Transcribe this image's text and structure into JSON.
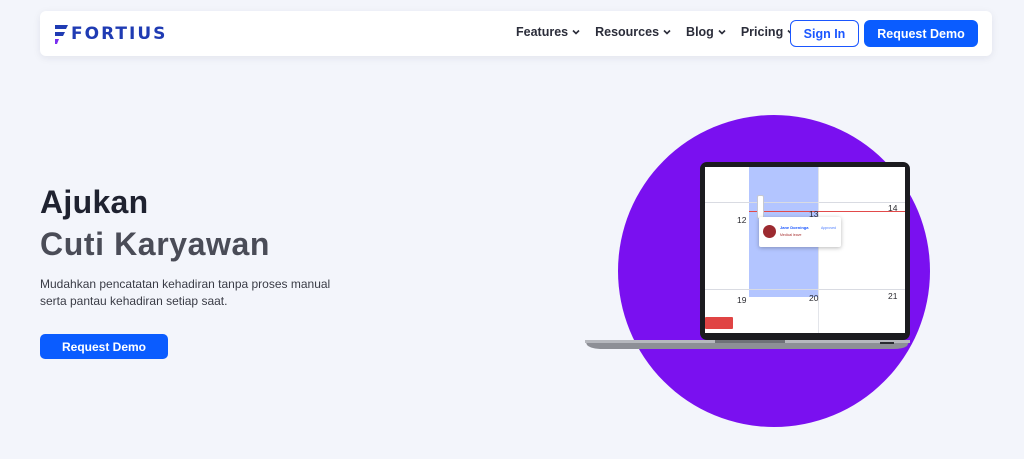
{
  "brand": {
    "name": "FORTIUS",
    "logo_icon": "fortius-logo-icon",
    "color": "#1f3bb3",
    "accent": "#7a2ff0"
  },
  "nav": {
    "items": [
      {
        "label": "Features"
      },
      {
        "label": "Resources"
      },
      {
        "label": "Blog"
      },
      {
        "label": "Pricing"
      }
    ],
    "signin_label": "Sign In",
    "demo_label": "Request Demo"
  },
  "hero": {
    "title_line1": "Ajukan",
    "title_line2": "Cuti Karyawan",
    "description": "Mudahkan pencatatan kehadiran tanpa proses manual serta pantau kehadiran setiap saat.",
    "cta_label": "Request Demo"
  },
  "mockup": {
    "days": [
      "12",
      "13",
      "14",
      "19",
      "20",
      "21"
    ],
    "popup": {
      "name": "Jane Doeninga",
      "sub": "Medical leave",
      "tag": "Approved"
    }
  },
  "colors": {
    "primary": "#0a5cff",
    "circle": "#7a10f0",
    "background": "#f3f5fb"
  }
}
